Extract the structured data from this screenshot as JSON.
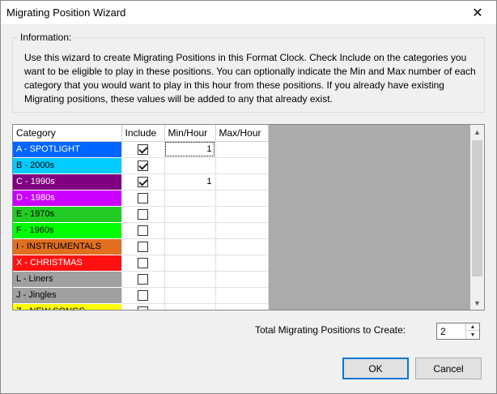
{
  "window": {
    "title": "Migrating Position Wizard",
    "close_glyph": "✕"
  },
  "info": {
    "legend": "Information:",
    "text": "Use this wizard to create Migrating Positions in this Format Clock. Check Include on the categories you want to be eligible to play in these positions. You can optionally indicate the Min and Max number of each category that you would want to play in this hour from these positions. If you already have existing Migrating positions, these values will be added to any that already exist."
  },
  "grid": {
    "headers": [
      "Category",
      "Include",
      "Min/Hour",
      "Max/Hour"
    ],
    "rows": [
      {
        "category": "A - SPOTLIGHT",
        "bg": "#0066ff",
        "fg": "#ffffff",
        "include": true,
        "min": "1",
        "max": ""
      },
      {
        "category": "B - 2000s",
        "bg": "#00ccff",
        "fg": "#000000",
        "include": true,
        "min": "",
        "max": ""
      },
      {
        "category": "C - 1990s",
        "bg": "#800080",
        "fg": "#ffffff",
        "include": true,
        "min": "1",
        "max": ""
      },
      {
        "category": "D - 1980s",
        "bg": "#cc00ff",
        "fg": "#ffffff",
        "include": false,
        "min": "",
        "max": ""
      },
      {
        "category": "E - 1970s",
        "bg": "#22cc22",
        "fg": "#000000",
        "include": false,
        "min": "",
        "max": ""
      },
      {
        "category": "F - 1960s",
        "bg": "#00ff00",
        "fg": "#000000",
        "include": false,
        "min": "",
        "max": ""
      },
      {
        "category": "I - INSTRUMENTALS",
        "bg": "#e07020",
        "fg": "#000000",
        "include": false,
        "min": "",
        "max": ""
      },
      {
        "category": "X - CHRISTMAS",
        "bg": "#ff1111",
        "fg": "#ffffff",
        "include": false,
        "min": "",
        "max": ""
      },
      {
        "category": "L - Liners",
        "bg": "#a0a0a0",
        "fg": "#000000",
        "include": false,
        "min": "",
        "max": ""
      },
      {
        "category": "J - Jingles",
        "bg": "#a0a0a0",
        "fg": "#000000",
        "include": false,
        "min": "",
        "max": ""
      },
      {
        "category": "Z - NEW SONGS",
        "bg": "#ffff00",
        "fg": "#000000",
        "include": false,
        "min": "",
        "max": ""
      }
    ]
  },
  "total": {
    "label": "Total Migrating Positions to Create:",
    "value": "2"
  },
  "buttons": {
    "ok": "OK",
    "cancel": "Cancel"
  },
  "icons": {
    "scroll_up": "▲",
    "scroll_down": "▼",
    "spin_up": "▲",
    "spin_down": "▼"
  }
}
